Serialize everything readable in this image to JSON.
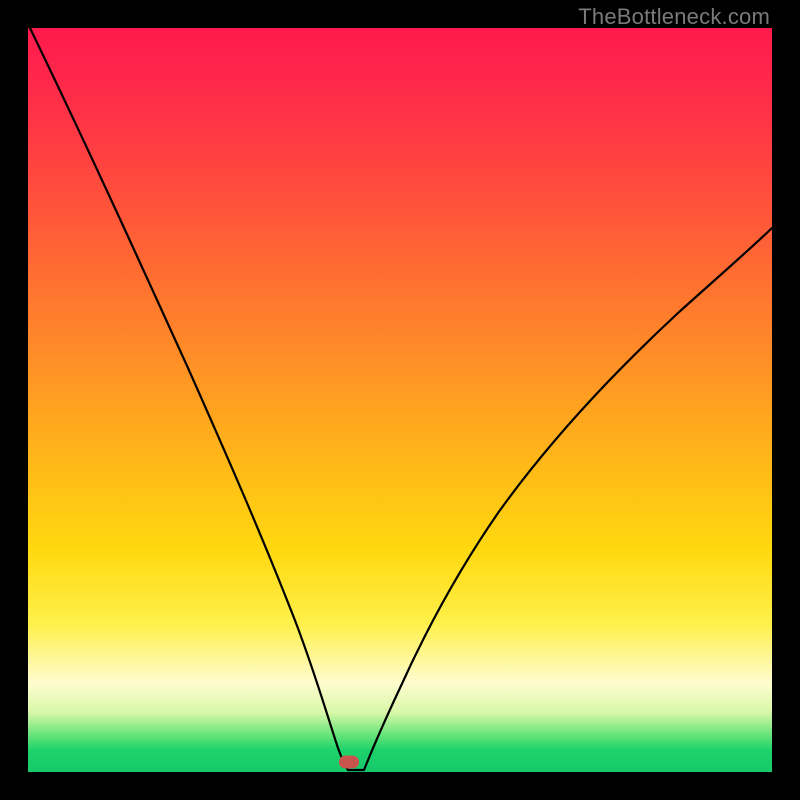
{
  "watermark": "TheBottleneck.com",
  "chart_data": {
    "type": "line",
    "title": "",
    "xlabel": "",
    "ylabel": "",
    "xlim": [
      0,
      100
    ],
    "ylim": [
      0,
      100
    ],
    "legend": false,
    "grid": false,
    "background_gradient": {
      "direction": "vertical",
      "stops": [
        {
          "pos": 0,
          "color": "#ff1a4d"
        },
        {
          "pos": 18,
          "color": "#ff4240"
        },
        {
          "pos": 45,
          "color": "#ff9026"
        },
        {
          "pos": 70,
          "color": "#ffd80f"
        },
        {
          "pos": 88,
          "color": "#fffccf"
        },
        {
          "pos": 100,
          "color": "#14c96a"
        }
      ]
    },
    "series": [
      {
        "name": "bottleneck-curve",
        "x": [
          0,
          4,
          8,
          12,
          16,
          20,
          24,
          28,
          32,
          36,
          38,
          40,
          42,
          44,
          48,
          52,
          56,
          60,
          66,
          72,
          80,
          88,
          96,
          100
        ],
        "y": [
          100,
          94,
          87,
          80,
          72,
          63,
          54,
          44,
          33,
          20,
          12,
          3,
          0,
          0,
          8,
          18,
          27,
          35,
          45,
          52,
          60,
          67,
          72,
          74
        ]
      }
    ],
    "annotations": [
      {
        "type": "marker",
        "name": "optimal-point",
        "x": 42,
        "y": 1,
        "color": "#c9544d"
      }
    ]
  }
}
